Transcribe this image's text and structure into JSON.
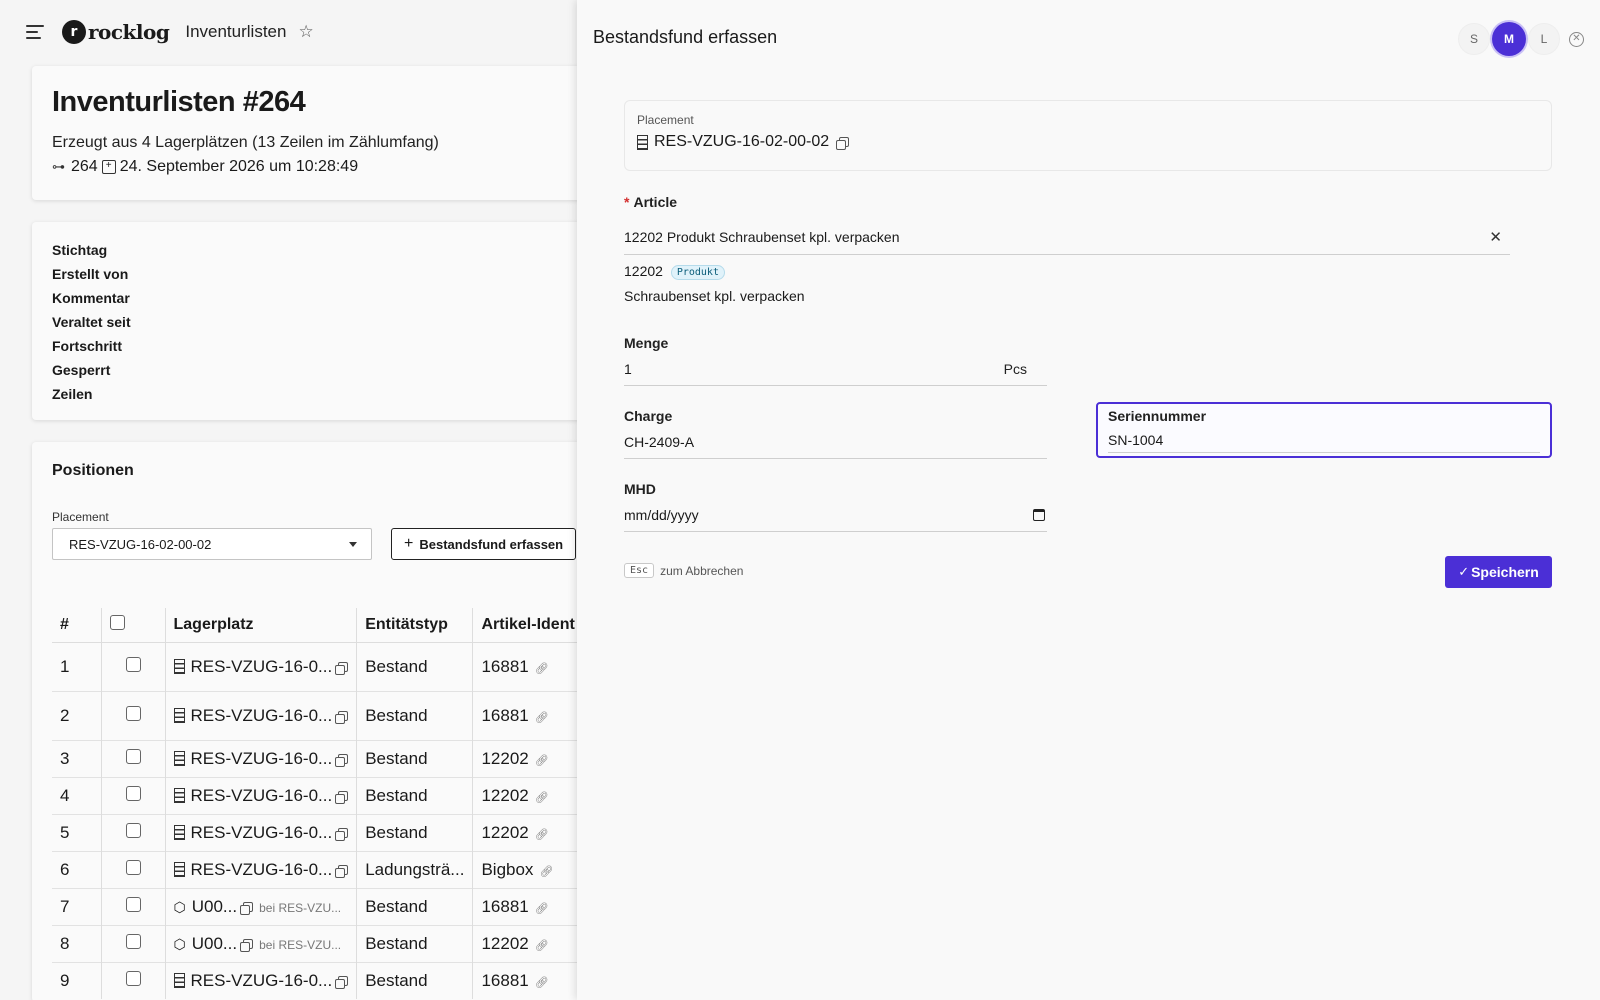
{
  "app": {
    "logo_mark": "r",
    "logo_text": "rocklog",
    "breadcrumb": "Inventurlisten"
  },
  "header": {
    "title": "Inventurlisten #264",
    "subtitle": "Erzeugt aus 4 Lagerplätzen (13 Zeilen im Zählumfang)",
    "id": "264",
    "created": "24. September 2026 um 10:28:49"
  },
  "properties": {
    "labels": [
      "Stichtag",
      "Erstellt von",
      "Kommentar",
      "Veraltet seit",
      "Fortschritt",
      "Gesperrt",
      "Zeilen"
    ]
  },
  "positions": {
    "title": "Positionen",
    "filter_label": "Placement",
    "filter_value": "RES-VZUG-16-02-00-02",
    "add_button": "Bestandsfund erfassen",
    "columns": [
      "#",
      "",
      "Lagerplatz",
      "Entitätstyp",
      "Artikel-Ident"
    ],
    "rows": [
      {
        "num": "1",
        "place": "RES-VZUG-16-0...",
        "kind": "shelf",
        "type": "Bestand",
        "article": "16881",
        "bei": ""
      },
      {
        "num": "2",
        "place": "RES-VZUG-16-0...",
        "kind": "shelf",
        "type": "Bestand",
        "article": "16881",
        "bei": ""
      },
      {
        "num": "3",
        "place": "RES-VZUG-16-0...",
        "kind": "shelf",
        "type": "Bestand",
        "article": "12202",
        "bei": ""
      },
      {
        "num": "4",
        "place": "RES-VZUG-16-0...",
        "kind": "shelf",
        "type": "Bestand",
        "article": "12202",
        "bei": ""
      },
      {
        "num": "5",
        "place": "RES-VZUG-16-0...",
        "kind": "shelf",
        "type": "Bestand",
        "article": "12202",
        "bei": ""
      },
      {
        "num": "6",
        "place": "RES-VZUG-16-0...",
        "kind": "shelf",
        "type": "Ladungsträ...",
        "article": "Bigbox",
        "bei": ""
      },
      {
        "num": "7",
        "place": "U00...",
        "kind": "box",
        "type": "Bestand",
        "article": "16881",
        "bei": "bei RES-VZU..."
      },
      {
        "num": "8",
        "place": "U00...",
        "kind": "box",
        "type": "Bestand",
        "article": "12202",
        "bei": "bei RES-VZU..."
      },
      {
        "num": "9",
        "place": "RES-VZUG-16-0...",
        "kind": "shelf",
        "type": "Bestand",
        "article": "16881",
        "bei": ""
      }
    ]
  },
  "drawer": {
    "title": "Bestandsfund erfassen",
    "sizes": [
      "S",
      "M",
      "L"
    ],
    "active_size": "M",
    "placement_label": "Placement",
    "placement_value": "RES-VZUG-16-02-00-02",
    "article_label": "Article",
    "article_value": "12202 Produkt Schraubenset kpl. verpacken",
    "article_code": "12202",
    "article_badge": "Produkt",
    "article_desc": "Schraubenset kpl. verpacken",
    "menge_label": "Menge",
    "menge_value": "1",
    "menge_unit": "Pcs",
    "charge_label": "Charge",
    "charge_value": "CH-2409-A",
    "serial_label": "Seriennummer",
    "serial_value": "SN-1004",
    "mhd_label": "MHD",
    "mhd_placeholder": "mm/dd/yyyy",
    "esc_key": "Esc",
    "esc_hint": "zum Abbrechen",
    "save_label": "Speichern"
  },
  "colors": {
    "accent": "#4b2fd6",
    "required": "#d32f2f",
    "badge_text": "#0b5d7a",
    "badge_bg": "#e0f2fa"
  },
  "icons": [
    "menu-icon",
    "star-icon",
    "key-icon",
    "calendar-icon",
    "shelf-icon",
    "copy-icon",
    "link-icon",
    "box-icon",
    "close-icon",
    "clear-icon",
    "check-icon",
    "plus-icon",
    "chevron-down-icon",
    "date-picker-icon"
  ]
}
